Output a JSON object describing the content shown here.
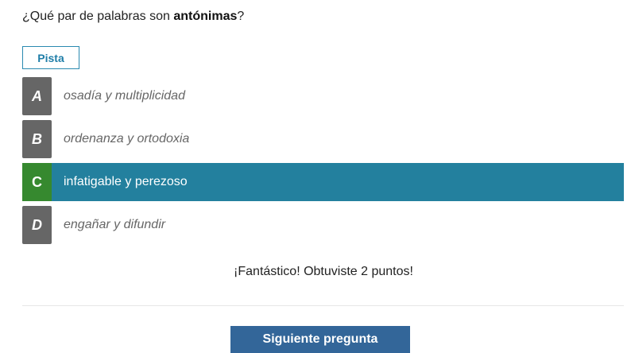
{
  "question": {
    "prefix": "¿Qué par de palabras son ",
    "bold": "antónimas",
    "suffix": "?"
  },
  "hint_label": "Pista",
  "options": [
    {
      "letter": "A",
      "text": "osadía y multiplicidad"
    },
    {
      "letter": "B",
      "text": "ordenanza y ortodoxia"
    },
    {
      "letter": "C",
      "text": "infatigable y perezoso"
    },
    {
      "letter": "D",
      "text": "engañar y difundir"
    }
  ],
  "selected": "C",
  "feedback": "¡Fantástico! Obtuviste 2 puntos!",
  "next_label": "Siguiente pregunta",
  "colors": {
    "selected": "#23809e",
    "correct": "#36892f",
    "button": "#336699"
  }
}
